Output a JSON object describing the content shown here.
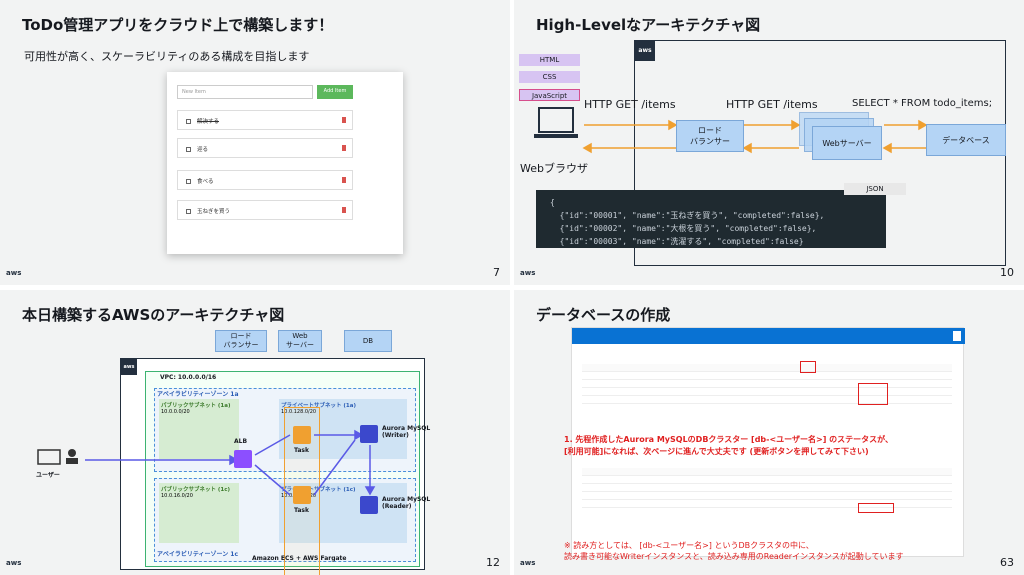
{
  "slides": [
    {
      "title": "ToDo管理アプリをクラウド上で構築します！",
      "subtitle": "可用性が高く、スケーラビリティのある構成を目指します",
      "page": "7",
      "todo": {
        "input_placeholder": "New Item",
        "add_label": "Add Item",
        "items": [
          "解決する",
          "迎る",
          "食べる",
          "玉ねぎを買う"
        ]
      }
    },
    {
      "title": "High-Levelなアーキテクチャ図",
      "page": "10",
      "tags": [
        "HTML",
        "CSS",
        "JavaScript"
      ],
      "http1": "HTTP GET /items",
      "http2": "HTTP GET /items",
      "sql": "SELECT * FROM todo_items;",
      "browser": "Webブラウザ",
      "lb": "ロード\nバランサー",
      "web": "Webサーバー",
      "db": "データベース",
      "json_tag": "JSON",
      "json_lines": [
        "{",
        "  {\"id\":\"00001\", \"name\":\"玉ねぎを買う\", \"completed\":false},",
        "  {\"id\":\"00002\", \"name\":\"大根を買う\", \"completed\":false},",
        "  {\"id\":\"00003\", \"name\":\"洗濯する\", \"completed\":false}",
        "}"
      ]
    },
    {
      "title": "本日構築するAWSのアーキテクチャ図",
      "page": "12",
      "legend": [
        "ロード\nバランサー",
        "Web\nサーバー",
        "DB"
      ],
      "vpc": "VPC: 10.0.0.0/16",
      "az1": "アベイラビリティーゾーン 1a",
      "az2": "アベイラビリティーゾーン 1c",
      "pub1": "パブリックサブネット (1a)",
      "pub1_cidr": "10.0.0.0/20",
      "pub2": "パブリックサブネット (1c)",
      "pub2_cidr": "10.0.16.0/20",
      "priv1": "プライベートサブネット (1a)",
      "priv1_cidr": "10.0.128.0/20",
      "priv2": "プライベートサブネット (1c)",
      "priv2_cidr": "10.0.144.0/20",
      "alb": "ALB",
      "task": "Task",
      "user": "ユーザー",
      "writer": "Aurora MySQL\n(Writer)",
      "reader": "Aurora MySQL\n(Reader)",
      "ecs": "Amazon ECS + AWS Fargate"
    },
    {
      "title": "データベースの作成",
      "page": "63",
      "note1": "1. 先程作成したAurora MySQLのDBクラスター [db-<ユーザー名>] のステータスが、",
      "note2": "[利用可能]になれば、次ページに進んで大丈夫です (更新ボタンを押してみて下さい)",
      "note3": "※ 読み方としては、 [db-<ユーザー名>] というDBクラスタの中に、",
      "note4": "読み書き可能なWriterインスタンスと、読み込み専用のReaderインスタンスが起動しています"
    }
  ]
}
